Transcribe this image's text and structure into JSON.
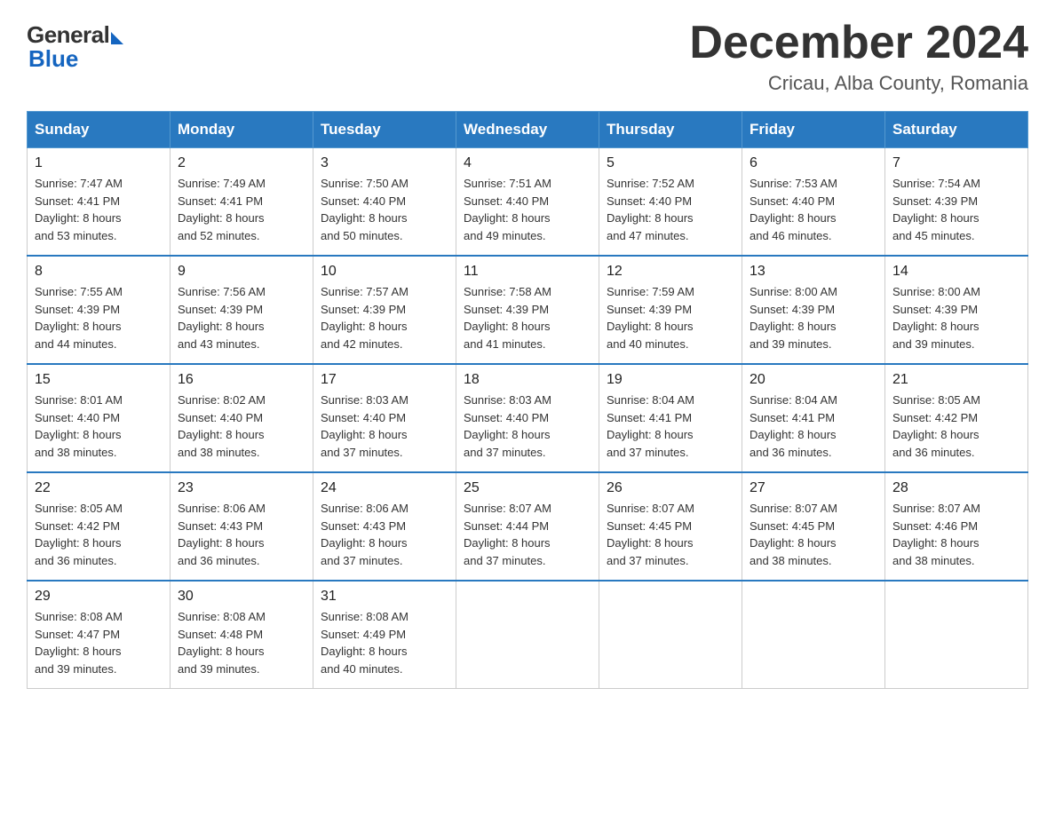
{
  "header": {
    "logo_general": "General",
    "logo_blue": "Blue",
    "title": "December 2024",
    "subtitle": "Cricau, Alba County, Romania"
  },
  "columns": [
    "Sunday",
    "Monday",
    "Tuesday",
    "Wednesday",
    "Thursday",
    "Friday",
    "Saturday"
  ],
  "weeks": [
    [
      {
        "day": "1",
        "sunrise": "Sunrise: 7:47 AM",
        "sunset": "Sunset: 4:41 PM",
        "daylight": "Daylight: 8 hours",
        "minutes": "and 53 minutes."
      },
      {
        "day": "2",
        "sunrise": "Sunrise: 7:49 AM",
        "sunset": "Sunset: 4:41 PM",
        "daylight": "Daylight: 8 hours",
        "minutes": "and 52 minutes."
      },
      {
        "day": "3",
        "sunrise": "Sunrise: 7:50 AM",
        "sunset": "Sunset: 4:40 PM",
        "daylight": "Daylight: 8 hours",
        "minutes": "and 50 minutes."
      },
      {
        "day": "4",
        "sunrise": "Sunrise: 7:51 AM",
        "sunset": "Sunset: 4:40 PM",
        "daylight": "Daylight: 8 hours",
        "minutes": "and 49 minutes."
      },
      {
        "day": "5",
        "sunrise": "Sunrise: 7:52 AM",
        "sunset": "Sunset: 4:40 PM",
        "daylight": "Daylight: 8 hours",
        "minutes": "and 47 minutes."
      },
      {
        "day": "6",
        "sunrise": "Sunrise: 7:53 AM",
        "sunset": "Sunset: 4:40 PM",
        "daylight": "Daylight: 8 hours",
        "minutes": "and 46 minutes."
      },
      {
        "day": "7",
        "sunrise": "Sunrise: 7:54 AM",
        "sunset": "Sunset: 4:39 PM",
        "daylight": "Daylight: 8 hours",
        "minutes": "and 45 minutes."
      }
    ],
    [
      {
        "day": "8",
        "sunrise": "Sunrise: 7:55 AM",
        "sunset": "Sunset: 4:39 PM",
        "daylight": "Daylight: 8 hours",
        "minutes": "and 44 minutes."
      },
      {
        "day": "9",
        "sunrise": "Sunrise: 7:56 AM",
        "sunset": "Sunset: 4:39 PM",
        "daylight": "Daylight: 8 hours",
        "minutes": "and 43 minutes."
      },
      {
        "day": "10",
        "sunrise": "Sunrise: 7:57 AM",
        "sunset": "Sunset: 4:39 PM",
        "daylight": "Daylight: 8 hours",
        "minutes": "and 42 minutes."
      },
      {
        "day": "11",
        "sunrise": "Sunrise: 7:58 AM",
        "sunset": "Sunset: 4:39 PM",
        "daylight": "Daylight: 8 hours",
        "minutes": "and 41 minutes."
      },
      {
        "day": "12",
        "sunrise": "Sunrise: 7:59 AM",
        "sunset": "Sunset: 4:39 PM",
        "daylight": "Daylight: 8 hours",
        "minutes": "and 40 minutes."
      },
      {
        "day": "13",
        "sunrise": "Sunrise: 8:00 AM",
        "sunset": "Sunset: 4:39 PM",
        "daylight": "Daylight: 8 hours",
        "minutes": "and 39 minutes."
      },
      {
        "day": "14",
        "sunrise": "Sunrise: 8:00 AM",
        "sunset": "Sunset: 4:39 PM",
        "daylight": "Daylight: 8 hours",
        "minutes": "and 39 minutes."
      }
    ],
    [
      {
        "day": "15",
        "sunrise": "Sunrise: 8:01 AM",
        "sunset": "Sunset: 4:40 PM",
        "daylight": "Daylight: 8 hours",
        "minutes": "and 38 minutes."
      },
      {
        "day": "16",
        "sunrise": "Sunrise: 8:02 AM",
        "sunset": "Sunset: 4:40 PM",
        "daylight": "Daylight: 8 hours",
        "minutes": "and 38 minutes."
      },
      {
        "day": "17",
        "sunrise": "Sunrise: 8:03 AM",
        "sunset": "Sunset: 4:40 PM",
        "daylight": "Daylight: 8 hours",
        "minutes": "and 37 minutes."
      },
      {
        "day": "18",
        "sunrise": "Sunrise: 8:03 AM",
        "sunset": "Sunset: 4:40 PM",
        "daylight": "Daylight: 8 hours",
        "minutes": "and 37 minutes."
      },
      {
        "day": "19",
        "sunrise": "Sunrise: 8:04 AM",
        "sunset": "Sunset: 4:41 PM",
        "daylight": "Daylight: 8 hours",
        "minutes": "and 37 minutes."
      },
      {
        "day": "20",
        "sunrise": "Sunrise: 8:04 AM",
        "sunset": "Sunset: 4:41 PM",
        "daylight": "Daylight: 8 hours",
        "minutes": "and 36 minutes."
      },
      {
        "day": "21",
        "sunrise": "Sunrise: 8:05 AM",
        "sunset": "Sunset: 4:42 PM",
        "daylight": "Daylight: 8 hours",
        "minutes": "and 36 minutes."
      }
    ],
    [
      {
        "day": "22",
        "sunrise": "Sunrise: 8:05 AM",
        "sunset": "Sunset: 4:42 PM",
        "daylight": "Daylight: 8 hours",
        "minutes": "and 36 minutes."
      },
      {
        "day": "23",
        "sunrise": "Sunrise: 8:06 AM",
        "sunset": "Sunset: 4:43 PM",
        "daylight": "Daylight: 8 hours",
        "minutes": "and 36 minutes."
      },
      {
        "day": "24",
        "sunrise": "Sunrise: 8:06 AM",
        "sunset": "Sunset: 4:43 PM",
        "daylight": "Daylight: 8 hours",
        "minutes": "and 37 minutes."
      },
      {
        "day": "25",
        "sunrise": "Sunrise: 8:07 AM",
        "sunset": "Sunset: 4:44 PM",
        "daylight": "Daylight: 8 hours",
        "minutes": "and 37 minutes."
      },
      {
        "day": "26",
        "sunrise": "Sunrise: 8:07 AM",
        "sunset": "Sunset: 4:45 PM",
        "daylight": "Daylight: 8 hours",
        "minutes": "and 37 minutes."
      },
      {
        "day": "27",
        "sunrise": "Sunrise: 8:07 AM",
        "sunset": "Sunset: 4:45 PM",
        "daylight": "Daylight: 8 hours",
        "minutes": "and 38 minutes."
      },
      {
        "day": "28",
        "sunrise": "Sunrise: 8:07 AM",
        "sunset": "Sunset: 4:46 PM",
        "daylight": "Daylight: 8 hours",
        "minutes": "and 38 minutes."
      }
    ],
    [
      {
        "day": "29",
        "sunrise": "Sunrise: 8:08 AM",
        "sunset": "Sunset: 4:47 PM",
        "daylight": "Daylight: 8 hours",
        "minutes": "and 39 minutes."
      },
      {
        "day": "30",
        "sunrise": "Sunrise: 8:08 AM",
        "sunset": "Sunset: 4:48 PM",
        "daylight": "Daylight: 8 hours",
        "minutes": "and 39 minutes."
      },
      {
        "day": "31",
        "sunrise": "Sunrise: 8:08 AM",
        "sunset": "Sunset: 4:49 PM",
        "daylight": "Daylight: 8 hours",
        "minutes": "and 40 minutes."
      },
      null,
      null,
      null,
      null
    ]
  ]
}
